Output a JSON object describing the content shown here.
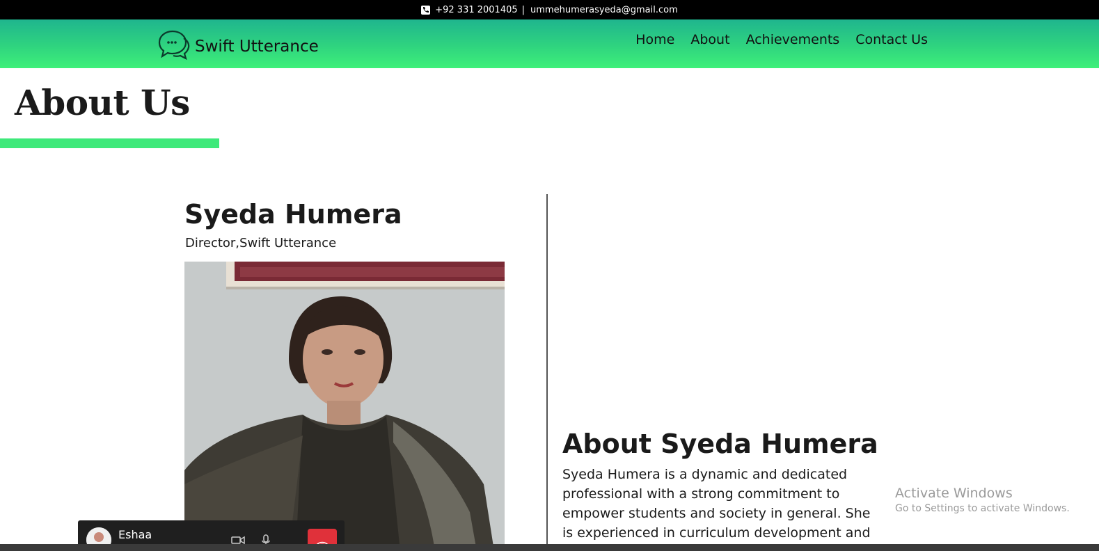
{
  "topbar": {
    "phone": "+92 331 2001405",
    "separator": "|",
    "email": "ummehumerasyeda@gmail.com",
    "icon": "phone-icon"
  },
  "header": {
    "brand": "Swift Utterance",
    "logo_icon": "chat-bubbles-icon",
    "nav": [
      "Home",
      "About",
      "Achievements",
      "Contact Us"
    ]
  },
  "page": {
    "title": "About Us"
  },
  "profile": {
    "name": "Syeda Humera",
    "role": "Director,Swift Utterance"
  },
  "about": {
    "heading": "About Syeda Humera",
    "text": "Syeda Humera is a dynamic and dedicated professional with a strong commitment to empower students and society in general. She is experienced in curriculum development and"
  },
  "watermark": {
    "line1": "Activate Windows",
    "line2": "Go to Settings to activate Windows."
  },
  "call": {
    "caller": "Eshaa",
    "icons": [
      "video-icon",
      "microphone-icon",
      "more-icon",
      "end-call-icon"
    ]
  },
  "colors": {
    "accent_green": "#3ee97a",
    "nav_gradient_top": "#1fb58e",
    "end_call_red": "#e0313a"
  }
}
